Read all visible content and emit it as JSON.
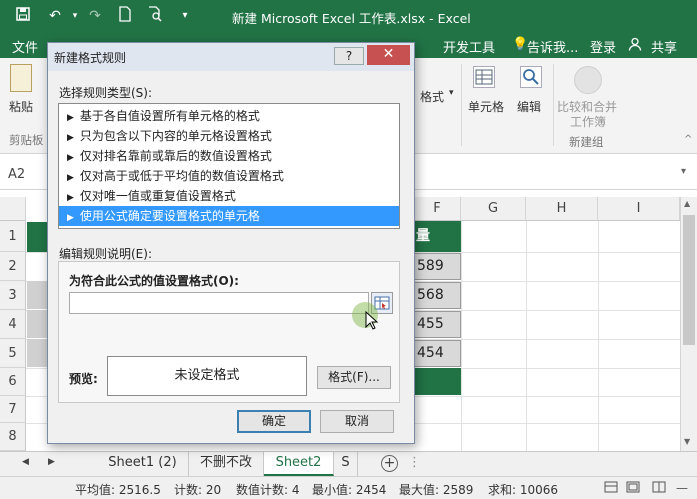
{
  "window": {
    "title": "新建 Microsoft Excel 工作表.xlsx - Excel"
  },
  "ribbon_tabs": [
    {
      "id": "file",
      "label": "文件"
    },
    {
      "id": "dev",
      "label": "开发工具"
    },
    {
      "id": "tell",
      "label": "告诉我..."
    },
    {
      "id": "login",
      "label": "登录"
    },
    {
      "id": "share",
      "label": "共享"
    }
  ],
  "ribbon": {
    "paste": "粘贴",
    "clipboard_group": "剪贴板",
    "format": "格式",
    "cells": "单元格",
    "edit": "编辑",
    "merge_line1": "比较和合并",
    "merge_line2": "工作簿",
    "new_group": "新建组"
  },
  "formula_bar": {
    "name_box": "A2"
  },
  "columns": [
    "F",
    "G",
    "H",
    "I"
  ],
  "row_numbers": [
    "1",
    "2",
    "3",
    "4",
    "5",
    "6",
    "7",
    "8"
  ],
  "cells": {
    "F1": "量",
    "F2": "589",
    "F3": "568",
    "F4": "455",
    "F5": "454"
  },
  "sheet_tabs": [
    {
      "label": "Sheet1 (2)",
      "active": false
    },
    {
      "label": "不删不改",
      "active": false
    },
    {
      "label": "Sheet2",
      "active": true
    },
    {
      "label": "S",
      "active": false
    }
  ],
  "status_bar": {
    "average": "平均值: 2516.5",
    "count": "计数: 20",
    "numeric_count": "数值计数: 4",
    "min": "最小值: 2454",
    "max": "最大值: 2589",
    "sum": "求和: 10066"
  },
  "dialog": {
    "title": "新建格式规则",
    "help": "?",
    "close": "✕",
    "select_rule_type_label": "选择规则类型(S):",
    "rule_types": [
      {
        "label": "基于各自值设置所有单元格的格式",
        "selected": false
      },
      {
        "label": "只为包含以下内容的单元格设置格式",
        "selected": false
      },
      {
        "label": "仅对排名靠前或靠后的数值设置格式",
        "selected": false
      },
      {
        "label": "仅对高于或低于平均值的数值设置格式",
        "selected": false
      },
      {
        "label": "仅对唯一值或重复值设置格式",
        "selected": false
      },
      {
        "label": "使用公式确定要设置格式的单元格",
        "selected": true
      }
    ],
    "edit_desc_label": "编辑规则说明(E):",
    "formula_label": "为符合此公式的值设置格式(O):",
    "formula_value": "",
    "preview_label": "预览:",
    "preview_text": "未设定格式",
    "format_button": "格式(F)...",
    "ok_button": "确定",
    "cancel_button": "取消"
  },
  "colors": {
    "excel_green": "#217346",
    "selection_blue": "#3399ff"
  }
}
